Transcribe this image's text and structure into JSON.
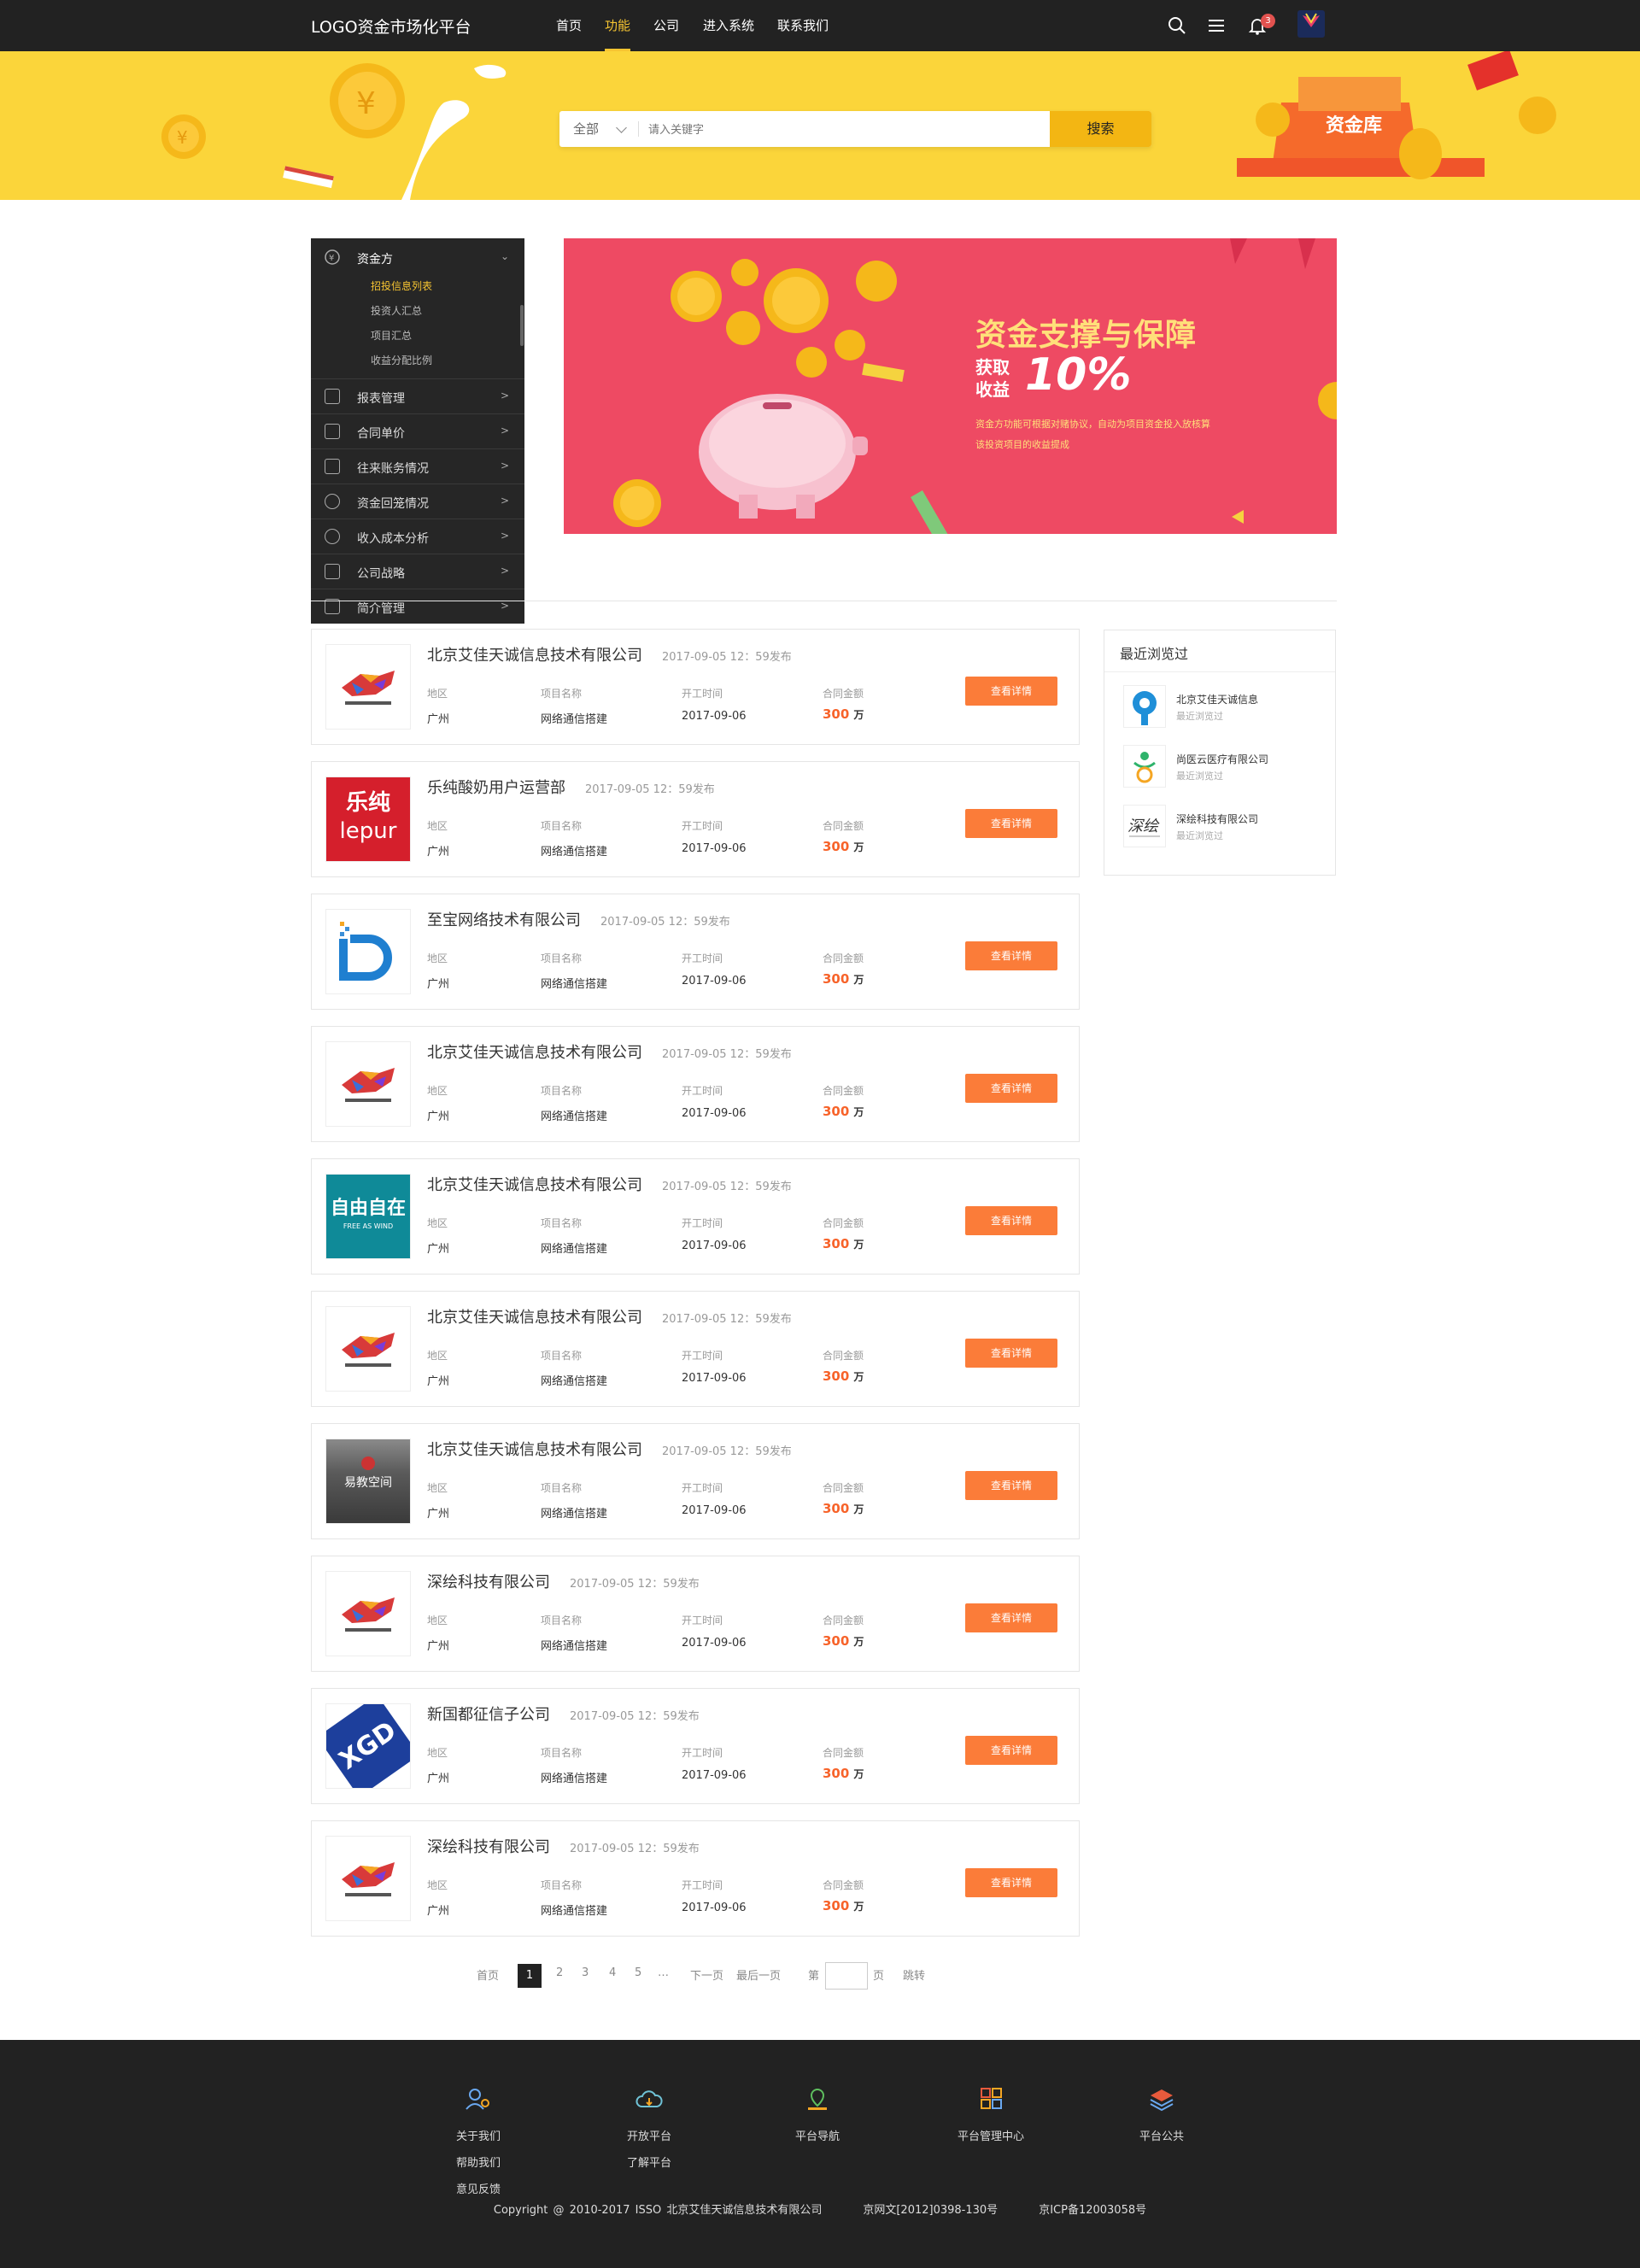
{
  "header": {
    "logo": "LOGO资金市场化平台",
    "nav": [
      "首页",
      "功能",
      "公司",
      "进入系统",
      "联系我们"
    ],
    "active_nav": "功能",
    "notification_count": "3"
  },
  "search": {
    "scope": "全部",
    "placeholder": "请入关键字",
    "button": "搜索",
    "hero_tag": "资金库"
  },
  "sidebar": {
    "head": "资金方",
    "subitems": [
      "招投信息列表",
      "投资人汇总",
      "项目汇总",
      "收益分配比例"
    ],
    "active_sub": "招投信息列表",
    "items": [
      "报表管理",
      "合同单价",
      "往来账务情况",
      "资金回笼情况",
      "收入成本分析",
      "公司战略",
      "简介管理"
    ]
  },
  "banner": {
    "title": "资金支撑与保障",
    "label": "获取收益",
    "value": "10%",
    "desc": "资金方功能可根据对赌协议，自动为项目资金投入放核算该投资项目的收益提成"
  },
  "list": {
    "labels": {
      "region": "地区",
      "project": "项目名称",
      "start": "开工时间",
      "amount": "合同金额"
    },
    "button": "查看详情",
    "cards": [
      {
        "name": "北京艾佳天诚信息技术有限公司",
        "date": "2017-09-05  12：59发布",
        "region": "广州",
        "project": "网络通信搭建",
        "start": "2017-09-06",
        "amount": "300",
        "unit": "万",
        "logo": "bull"
      },
      {
        "name": "乐纯酸奶用户运营部",
        "date": "2017-09-05  12：59发布",
        "region": "广州",
        "project": "网络通信搭建",
        "start": "2017-09-06",
        "amount": "300",
        "unit": "万",
        "logo": "lepur"
      },
      {
        "name": "至宝网络技术有限公司",
        "date": "2017-09-05  12：59发布",
        "region": "广州",
        "project": "网络通信搭建",
        "start": "2017-09-06",
        "amount": "300",
        "unit": "万",
        "logo": "b"
      },
      {
        "name": "北京艾佳天诚信息技术有限公司",
        "date": "2017-09-05  12：59发布",
        "region": "广州",
        "project": "网络通信搭建",
        "start": "2017-09-06",
        "amount": "300",
        "unit": "万",
        "logo": "bull"
      },
      {
        "name": "北京艾佳天诚信息技术有限公司",
        "date": "2017-09-05  12：59发布",
        "region": "广州",
        "project": "网络通信搭建",
        "start": "2017-09-06",
        "amount": "300",
        "unit": "万",
        "logo": "ziyou"
      },
      {
        "name": "北京艾佳天诚信息技术有限公司",
        "date": "2017-09-05  12：59发布",
        "region": "广州",
        "project": "网络通信搭建",
        "start": "2017-09-06",
        "amount": "300",
        "unit": "万",
        "logo": "bull"
      },
      {
        "name": "北京艾佳天诚信息技术有限公司",
        "date": "2017-09-05  12：59发布",
        "region": "广州",
        "project": "网络通信搭建",
        "start": "2017-09-06",
        "amount": "300",
        "unit": "万",
        "logo": "yijiao"
      },
      {
        "name": "深绘科技有限公司",
        "date": "2017-09-05  12：59发布",
        "region": "广州",
        "project": "网络通信搭建",
        "start": "2017-09-06",
        "amount": "300",
        "unit": "万",
        "logo": "bull"
      },
      {
        "name": "新国都征信子公司",
        "date": "2017-09-05  12：59发布",
        "region": "广州",
        "project": "网络通信搭建",
        "start": "2017-09-06",
        "amount": "300",
        "unit": "万",
        "logo": "xgd"
      },
      {
        "name": "深绘科技有限公司",
        "date": "2017-09-05  12：59发布",
        "region": "广州",
        "project": "网络通信搭建",
        "start": "2017-09-06",
        "amount": "300",
        "unit": "万",
        "logo": "bull"
      }
    ]
  },
  "recent": {
    "title": "最近浏览过",
    "items": [
      {
        "name": "北京艾佳天诚信息",
        "sub": "最近浏览过"
      },
      {
        "name": "尚医云医疗有限公司",
        "sub": "最近浏览过"
      },
      {
        "name": "深绘科技有限公司",
        "sub": "最近浏览过"
      }
    ]
  },
  "pagination": {
    "first": "首页",
    "current": "1",
    "pages": [
      "2",
      "3",
      "4",
      "5"
    ],
    "ellipsis": "…",
    "next": "下一页",
    "last": "最后一页",
    "goto_prefix": "第",
    "goto_suffix": "页",
    "jump": "跳转"
  },
  "footer": {
    "cols": [
      {
        "links": [
          "关于我们",
          "帮助我们",
          "意见反馈"
        ],
        "icon": "users-icon"
      },
      {
        "links": [
          "开放平台",
          "了解平台"
        ],
        "icon": "cloud-icon"
      },
      {
        "links": [
          "平台导航"
        ],
        "icon": "map-pin-icon"
      },
      {
        "links": [
          "平台管理中心"
        ],
        "icon": "grid-icon"
      },
      {
        "links": [
          "平台公共"
        ],
        "icon": "layers-icon"
      }
    ],
    "copyright": "Copyright @ 2010-2017 ISSO 北京艾佳天诚信息技术有限公司",
    "license": "京网文[2012]0398-130号",
    "icp": "京ICP备12003058号"
  },
  "colors": {
    "accent": "#f7c531",
    "hero": "#fbd53a",
    "button": "#fb7c39",
    "banner": "#ee4a63",
    "dark": "#222222"
  }
}
